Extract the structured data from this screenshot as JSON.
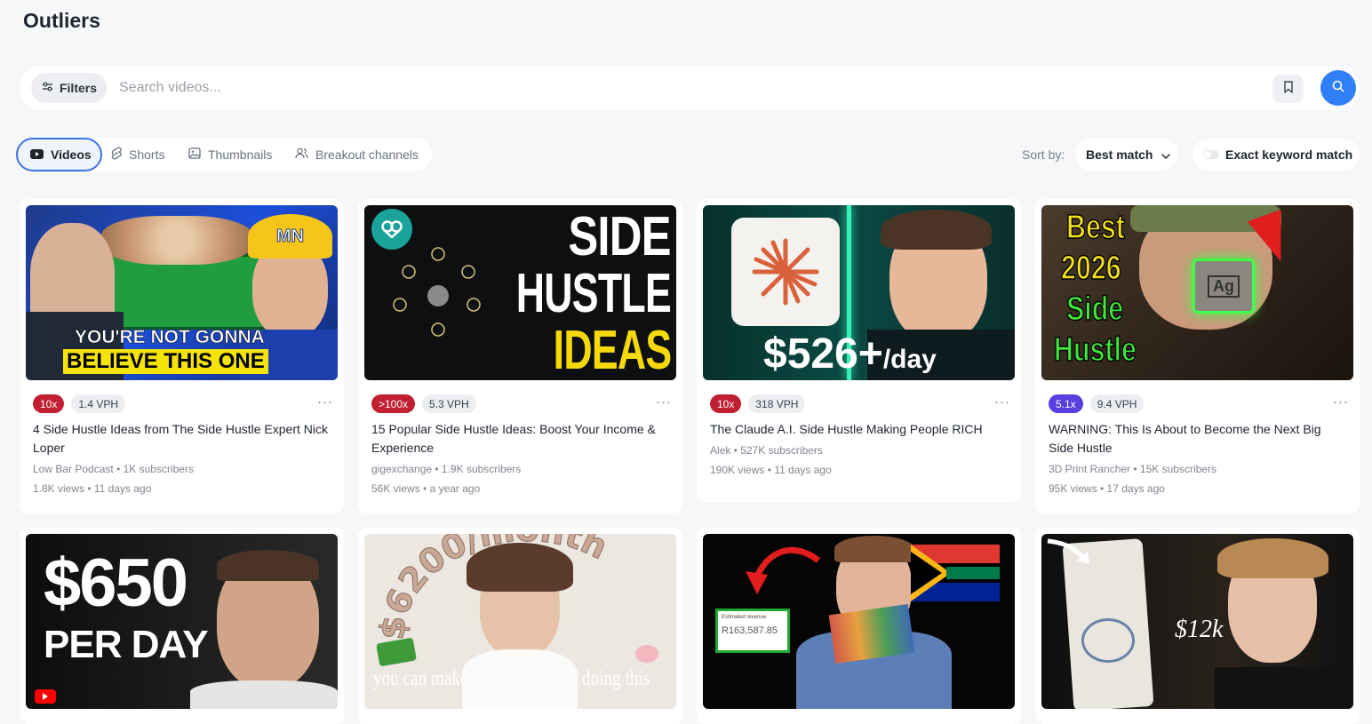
{
  "page": {
    "title": "Outliers"
  },
  "search": {
    "filters_label": "Filters",
    "placeholder": "Search videos..."
  },
  "tabs": [
    {
      "label": "Videos"
    },
    {
      "label": "Shorts"
    },
    {
      "label": "Thumbnails"
    },
    {
      "label": "Breakout channels"
    }
  ],
  "sort": {
    "label": "Sort by:",
    "value": "Best match"
  },
  "exact_match": {
    "label": "Exact keyword match"
  },
  "colors": {
    "accent": "#2f7ff7",
    "mult_red": "#c02032",
    "mult_purple": "#5a3fe0"
  },
  "videos": [
    {
      "multiplier": "10x",
      "vph": "1.4 VPH",
      "title": "4 Side Hustle Ideas from The Side Hustle Expert Nick Loper",
      "channel": "Low Bar Podcast • 1K subscribers",
      "meta": "1.8K views • 11 days ago",
      "thumb": {
        "text1": "YOU'RE NOT GONNA",
        "text2": "BELIEVE THIS ONE",
        "cap": "MN"
      }
    },
    {
      "multiplier": ">100x",
      "vph": "5.3 VPH",
      "title": "15 Popular Side Hustle Ideas: Boost Your Income & Experience",
      "channel": "gigexchange • 1.9K subscribers",
      "meta": "56K views • a year ago",
      "thumb": {
        "line1": "SIDE",
        "line2": "HUSTLE",
        "line3": "IDEAS"
      }
    },
    {
      "multiplier": "10x",
      "vph": "318 VPH",
      "title": "The Claude A.I. Side Hustle Making People RICH",
      "channel": "Alek • 527K subscribers",
      "meta": "190K views • 11 days ago",
      "thumb": {
        "amount": "$526+",
        "unit": "/day"
      }
    },
    {
      "multiplier": "5.1x",
      "vph": "9.4 VPH",
      "title": "WARNING: This Is About to Become the Next Big Side Hustle",
      "channel": "3D Print Rancher • 15K subscribers",
      "meta": "95K views • 17 days ago",
      "thumb": {
        "line1": "Best",
        "line2": "2026",
        "line3": "Side",
        "line4": "Hustle",
        "chip": "Ag"
      }
    }
  ],
  "videos_row2": [
    {
      "thumb": {
        "line1": "$650",
        "line2": "PER DAY"
      }
    },
    {
      "thumb": {
        "arc": "$6200/month",
        "left": "you can make",
        "right": "doing this"
      }
    },
    {
      "thumb": {
        "label": "Estimated revenue",
        "value": "R163,587.85"
      }
    },
    {
      "thumb": {
        "amount": "$12k"
      }
    }
  ]
}
